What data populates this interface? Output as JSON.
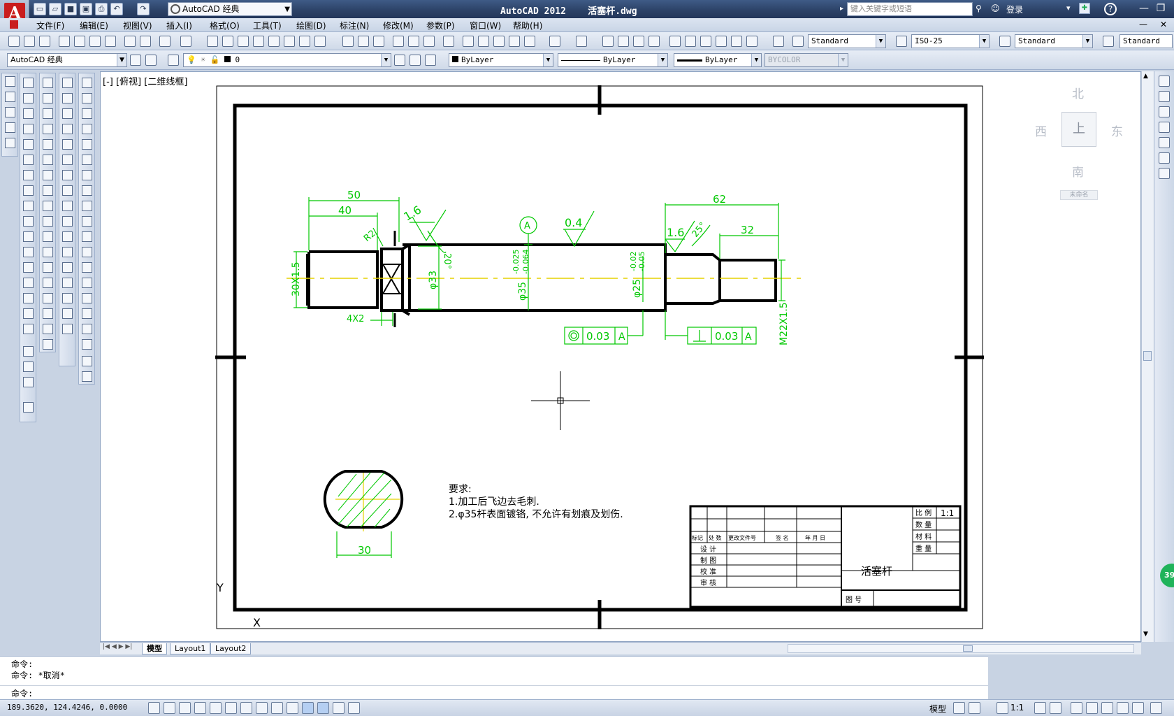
{
  "titlebar": {
    "app_title": "AutoCAD 2012    活塞杆.dwg",
    "workspace": "AutoCAD 经典",
    "search_placeholder": "键入关键字或短语",
    "login_label": "登录",
    "help_icon": "question-icon"
  },
  "menu": [
    "文件(F)",
    "编辑(E)",
    "视图(V)",
    "插入(I)",
    "格式(O)",
    "工具(T)",
    "绘图(D)",
    "标注(N)",
    "修改(M)",
    "参数(P)",
    "窗口(W)",
    "帮助(H)"
  ],
  "styles_toolbar": {
    "text_style": "Standard",
    "dim_style": "ISO-25",
    "table_style": "Standard",
    "multileader_style": "Standard"
  },
  "layers_toolbar": {
    "workspace": "AutoCAD 经典",
    "layer": "0",
    "color": "ByLayer",
    "linetype": "ByLayer",
    "lineweight": "ByLayer",
    "plotstyle": "BYCOLOR"
  },
  "viewport": {
    "label": "[-] [俯视] [二维线框]"
  },
  "viewcube": {
    "north": "北",
    "south": "南",
    "east": "东",
    "west": "西",
    "top_face": "上",
    "wcs": "未命名"
  },
  "drawing": {
    "dims": {
      "d50": "50",
      "d40": "40",
      "d62": "62",
      "d32": "32",
      "d30": "30",
      "r2": "R2",
      "chamfer": "4X2",
      "thread_left": "30X1.5",
      "thread_right": "M22X1.5",
      "dia33": "φ33",
      "dia35": "φ35",
      "tol35_up": "-0.025",
      "tol35_lo": "-0.064",
      "dia25": "φ25",
      "tol25_up": "-0.02",
      "tol25_lo": "-0.05",
      "angle20": "20°",
      "angle25": "25°",
      "rough1": "1.6",
      "rough2": "0.4",
      "rough3": "1.6",
      "datum": "A",
      "fcf1_val": "0.03",
      "fcf1_ref": "A",
      "fcf2_val": "0.03",
      "fcf2_ref": "A"
    },
    "notes": {
      "heading": "要求:",
      "line1": "1.加工后飞边去毛刺.",
      "line2": "2.φ35杆表面镀铬, 不允许有划痕及划伤."
    },
    "title_block": {
      "scale_label": "比 例",
      "scale_value": "1:1",
      "qty_label": "数 量",
      "material_label": "材 料",
      "weight_label": "重 量",
      "part_name": "活塞杆",
      "drawing_no_label": "图  号",
      "mark_label": "标记",
      "place_label": "处 数",
      "doc_label": "更改文件号",
      "sign_label": "签 名",
      "date_label": "年 月 日",
      "design_label": "设 计",
      "draw_label": "制 图",
      "check_label": "校 准",
      "review_label": "审 核"
    },
    "ucs_y": "Y",
    "ucs_x": "X"
  },
  "tabs": {
    "model": "模型",
    "layout1": "Layout1",
    "layout2": "Layout2"
  },
  "command": {
    "line1": "命令:",
    "line2": "命令: *取消*",
    "prompt": "命令:"
  },
  "status": {
    "coords": "189.3620, 124.4246, 0.0000",
    "model_label": "模型",
    "scale": "1:1",
    "badge": "39"
  }
}
